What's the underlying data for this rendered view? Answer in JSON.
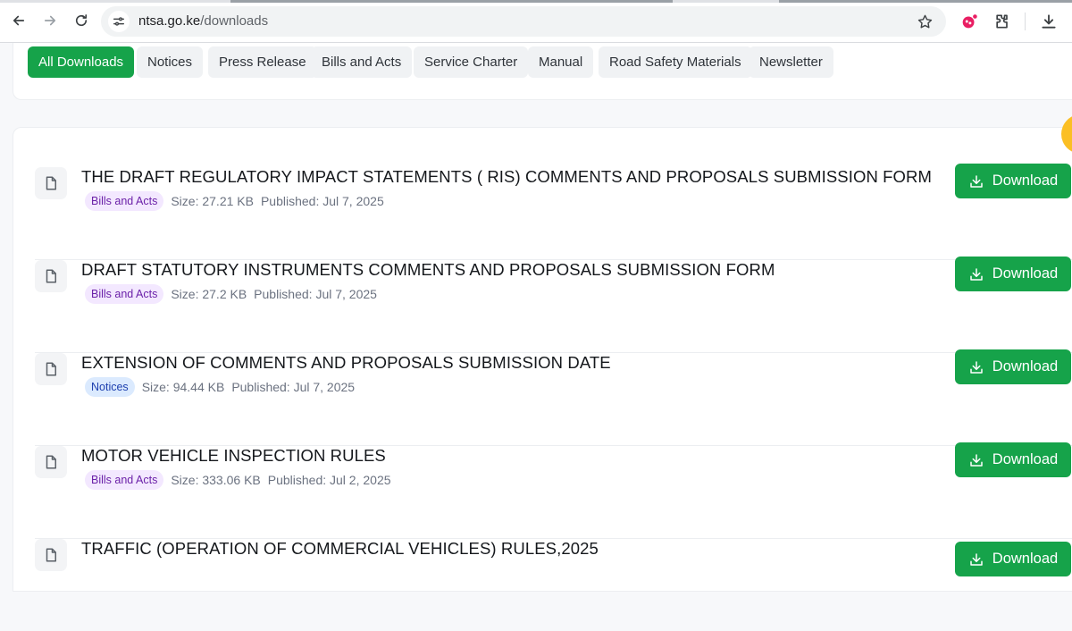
{
  "browser": {
    "url_host": "ntsa.go.ke",
    "url_path": "/downloads",
    "icons": [
      "back-arrow-icon",
      "forward-arrow-icon",
      "reload-icon",
      "site-info-icon",
      "star-icon",
      "extension-icon",
      "puzzle-icon",
      "download-icon"
    ]
  },
  "filters": [
    {
      "label": "All Downloads",
      "active": true
    },
    {
      "label": "Notices",
      "active": false
    },
    {
      "label": "Press Release",
      "active": false
    },
    {
      "label": "Bills and Acts",
      "active": false
    },
    {
      "label": "Service Charter",
      "active": false
    },
    {
      "label": "Manual",
      "active": false
    },
    {
      "label": "Road Safety Materials",
      "active": false
    },
    {
      "label": "Newsletter",
      "active": false
    }
  ],
  "download_label": "Download",
  "colors": {
    "accent_green": "#16a34a",
    "bills_badge_bg": "#f3e8ff",
    "bills_badge_text": "#6b21a8",
    "notices_badge_bg": "#dbeafe",
    "notices_badge_text": "#1e40af"
  },
  "documents": [
    {
      "title": "THE DRAFT REGULATORY IMPACT STATEMENTS ( RIS) COMMENTS AND PROPOSALS SUBMISSION FORM",
      "category": "Bills and Acts",
      "size": "Size: 27.21 KB",
      "published": "Published: Jul 7, 2025"
    },
    {
      "title": "DRAFT STATUTORY INSTRUMENTS COMMENTS AND PROPOSALS SUBMISSION FORM",
      "category": "Bills and Acts",
      "size": "Size: 27.2 KB",
      "published": "Published: Jul 7, 2025"
    },
    {
      "title": "EXTENSION OF COMMENTS AND PROPOSALS SUBMISSION DATE",
      "category": "Notices",
      "size": "Size: 94.44 KB",
      "published": "Published: Jul 7, 2025"
    },
    {
      "title": "MOTOR VEHICLE INSPECTION RULES",
      "category": "Bills and Acts",
      "size": "Size: 333.06 KB",
      "published": "Published: Jul 2, 2025"
    },
    {
      "title": "TRAFFIC (OPERATION OF COMMERCIAL VEHICLES) RULES,2025",
      "category": "",
      "size": "",
      "published": ""
    }
  ]
}
